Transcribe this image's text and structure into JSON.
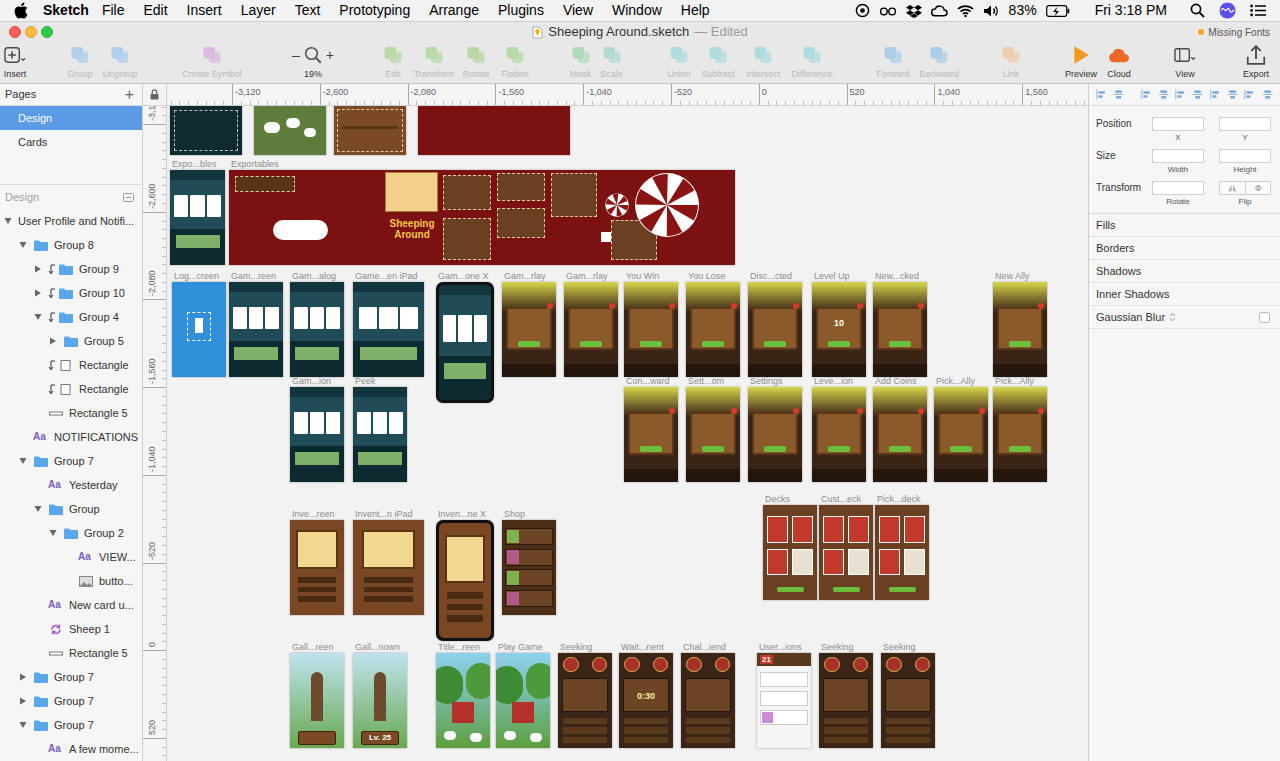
{
  "menubar": {
    "app": "Sketch",
    "menus": [
      "File",
      "Edit",
      "Insert",
      "Layer",
      "Text",
      "Prototyping",
      "Arrange",
      "Plugins",
      "View",
      "Window",
      "Help"
    ],
    "battery": "83%",
    "clock": "Fri 3:18 PM"
  },
  "window": {
    "title": "Sheeping Around.sketch",
    "edited": "— Edited",
    "warning": "Missing Fonts"
  },
  "toolbar": {
    "clusters": [
      {
        "items": [
          {
            "label": "Insert",
            "disabled": false,
            "color": "#4a4a4a"
          }
        ]
      },
      {
        "items": [
          {
            "label": "Group",
            "disabled": true,
            "color": "#8cc0ec"
          },
          {
            "label": "Ungroup",
            "disabled": true,
            "color": "#8cc0ec"
          }
        ]
      },
      {
        "items": [
          {
            "label": "Create Symbol",
            "disabled": true,
            "color": "#d6a0e0"
          }
        ]
      },
      {
        "items": [
          {
            "label": "Edit",
            "disabled": true,
            "color": "#9ccf7f"
          },
          {
            "label": "Transform",
            "disabled": true,
            "color": "#9ccf7f"
          },
          {
            "label": "Rotate",
            "disabled": true,
            "color": "#9ccf7f"
          },
          {
            "label": "Flatten",
            "disabled": true,
            "color": "#9ccf7f"
          }
        ]
      },
      {
        "items": [
          {
            "label": "Mask",
            "disabled": true,
            "color": "#8fd0a0"
          },
          {
            "label": "Scale",
            "disabled": true,
            "color": "#8fd0c8"
          }
        ]
      },
      {
        "items": [
          {
            "label": "Union",
            "disabled": true,
            "color": "#8ed3d6"
          },
          {
            "label": "Subtract",
            "disabled": true,
            "color": "#8ed3d6"
          },
          {
            "label": "Intersect",
            "disabled": true,
            "color": "#8ed3d6"
          },
          {
            "label": "Difference",
            "disabled": true,
            "color": "#8ed3d6"
          }
        ]
      },
      {
        "items": [
          {
            "label": "Forward",
            "disabled": true,
            "color": "#86bde8"
          },
          {
            "label": "Backward",
            "disabled": true,
            "color": "#86bde8"
          }
        ]
      },
      {
        "items": [
          {
            "label": "Link",
            "disabled": true,
            "color": "#f0c08c"
          }
        ]
      },
      {
        "items": [
          {
            "label": "Preview",
            "disabled": false,
            "color": "#f39a1c"
          },
          {
            "label": "Cloud",
            "disabled": false,
            "color": "#ef6a2a"
          }
        ]
      },
      {
        "items": [
          {
            "label": "View",
            "disabled": false,
            "color": "#4a4a4a"
          }
        ]
      },
      {
        "items": [
          {
            "label": "Export",
            "disabled": false,
            "color": "#4a4a4a"
          }
        ]
      }
    ],
    "zoom": {
      "minus": "–",
      "plus": "+",
      "value": "19%"
    }
  },
  "pages": {
    "header": "Pages",
    "add": "+",
    "items": [
      {
        "label": "Design",
        "selected": true
      },
      {
        "label": "Cards",
        "selected": false
      }
    ]
  },
  "layers": {
    "header": "Design",
    "items": [
      {
        "name": "User Profile and Notifi...",
        "kind": "artboard",
        "depth": 0,
        "expandable": true,
        "expanded": true,
        "masked": false
      },
      {
        "name": "Group 8",
        "kind": "group",
        "depth": 1,
        "expandable": true,
        "expanded": true,
        "masked": false
      },
      {
        "name": "Group 9",
        "kind": "group",
        "depth": 2,
        "expandable": true,
        "expanded": false,
        "masked": true
      },
      {
        "name": "Group 10",
        "kind": "group",
        "depth": 2,
        "expandable": true,
        "expanded": false,
        "masked": true
      },
      {
        "name": "Group 4",
        "kind": "group",
        "depth": 2,
        "expandable": true,
        "expanded": true,
        "masked": true
      },
      {
        "name": "Group 5",
        "kind": "group",
        "depth": 3,
        "expandable": true,
        "expanded": false,
        "masked": false
      },
      {
        "name": "Rectangle",
        "kind": "shape",
        "depth": 2,
        "expandable": false,
        "expanded": false,
        "masked": true
      },
      {
        "name": "Rectangle",
        "kind": "shape",
        "depth": 2,
        "expandable": false,
        "expanded": false,
        "masked": true
      },
      {
        "name": "Rectangle 5",
        "kind": "line",
        "depth": 2,
        "expandable": false,
        "expanded": false,
        "masked": false
      },
      {
        "name": "NOTIFICATIONS",
        "kind": "text",
        "icon_text": "Aa",
        "depth": 1,
        "expandable": false,
        "expanded": false,
        "masked": false
      },
      {
        "name": "Group 7",
        "kind": "group",
        "depth": 1,
        "expandable": true,
        "expanded": true,
        "masked": false
      },
      {
        "name": "Yesterday",
        "kind": "text",
        "icon_text": "Aa",
        "depth": 2,
        "expandable": false,
        "expanded": false,
        "masked": false
      },
      {
        "name": "Group",
        "kind": "group",
        "depth": 2,
        "expandable": true,
        "expanded": true,
        "masked": false
      },
      {
        "name": "Group 2",
        "kind": "group",
        "depth": 3,
        "expandable": true,
        "expanded": true,
        "masked": false
      },
      {
        "name": "VIEW...",
        "kind": "text",
        "icon_text": "Aa",
        "depth": 4,
        "expandable": false,
        "expanded": false,
        "masked": false
      },
      {
        "name": "butto...",
        "kind": "image",
        "depth": 4,
        "expandable": false,
        "expanded": false,
        "masked": false
      },
      {
        "name": "New card u...",
        "kind": "text",
        "icon_text": "Aa",
        "depth": 2,
        "expandable": false,
        "expanded": false,
        "masked": false
      },
      {
        "name": "Sheep 1",
        "kind": "symbol",
        "depth": 2,
        "expandable": false,
        "expanded": false,
        "masked": false
      },
      {
        "name": "Rectangle 5",
        "kind": "line",
        "depth": 2,
        "expandable": false,
        "expanded": false,
        "masked": false
      },
      {
        "name": "Group 7",
        "kind": "group",
        "depth": 1,
        "expandable": true,
        "expanded": false,
        "masked": false
      },
      {
        "name": "Group 7",
        "kind": "group",
        "depth": 1,
        "expandable": true,
        "expanded": false,
        "masked": false
      },
      {
        "name": "Group 7",
        "kind": "group",
        "depth": 1,
        "expandable": true,
        "expanded": true,
        "masked": false
      },
      {
        "name": "A few mome...",
        "kind": "text",
        "icon_text": "Aa",
        "depth": 2,
        "expandable": false,
        "expanded": false,
        "masked": false
      }
    ]
  },
  "rulers": {
    "x": [
      "-3,120",
      "-2,600",
      "-2,080",
      "-1,560",
      "-1,040",
      "-520",
      "0",
      "520",
      "1,040",
      "1,560"
    ],
    "y": [
      "-3,1",
      "-2,600",
      "-2,080",
      "-1,560",
      "-1,040",
      "-520",
      "0",
      "520"
    ]
  },
  "inspector": {
    "rows": [
      {
        "label": "Position",
        "captions": [
          "X",
          "Y"
        ]
      },
      {
        "label": "Size",
        "captions": [
          "Width",
          "Height"
        ]
      }
    ],
    "transform": {
      "label": "Transform",
      "rotate": "Rotate",
      "flip": "Flip"
    },
    "sections": [
      {
        "label": "Fills"
      },
      {
        "label": "Borders"
      },
      {
        "label": "Shadows"
      },
      {
        "label": "Inner Shadows"
      },
      {
        "label": "Gaussian Blur",
        "checked": false
      }
    ]
  },
  "canvas": {
    "artboards": [
      {
        "kind": "dark"
      },
      {
        "kind": "sheep"
      },
      {
        "kind": "crate"
      },
      {
        "kind": "red"
      },
      {
        "label": "Expo...bles",
        "kind": "game"
      },
      {
        "label": "Exportables",
        "kind": "sheet",
        "text": "Sheeping Around"
      },
      {
        "label": "Log...creen",
        "kind": "splash"
      },
      {
        "label": "Gam...reen",
        "kind": "game"
      },
      {
        "label": "Gam...alog",
        "kind": "game"
      },
      {
        "label": "Game...en iPad",
        "kind": "game"
      },
      {
        "label": "Gam...one X",
        "kind": "phone"
      },
      {
        "label": "Gam...rlay",
        "kind": "modal"
      },
      {
        "label": "Gam...rlay",
        "kind": "modal"
      },
      {
        "label": "You Win",
        "kind": "modal"
      },
      {
        "label": "You Lose",
        "kind": "modal"
      },
      {
        "label": "Disc...cted",
        "kind": "modal"
      },
      {
        "label": "Level Up",
        "kind": "modal",
        "text": "10"
      },
      {
        "label": "New...cked",
        "kind": "modal"
      },
      {
        "label": "New Ally",
        "kind": "modal"
      },
      {
        "label": "Gam...ion",
        "kind": "game"
      },
      {
        "label": "Peek",
        "kind": "game"
      },
      {
        "label": "Con...ward",
        "kind": "modal"
      },
      {
        "label": "Sett...om",
        "kind": "modal"
      },
      {
        "label": "Settings",
        "kind": "modal"
      },
      {
        "label": "Leve...ion",
        "kind": "modal"
      },
      {
        "label": "Add Coins",
        "kind": "modal"
      },
      {
        "label": "Pick...Ally",
        "kind": "modal"
      },
      {
        "label": "Pick...Ally",
        "kind": "modal"
      },
      {
        "label": "Inve...reen",
        "kind": "inventory"
      },
      {
        "label": "Invent...n iPad",
        "kind": "inventory"
      },
      {
        "label": "Inven...ne X",
        "kind": "handset"
      },
      {
        "label": "Shop",
        "kind": "shop"
      },
      {
        "label": "Decks",
        "kind": "deck"
      },
      {
        "label": "Cust...eck",
        "kind": "deck"
      },
      {
        "label": "Pick...deck",
        "kind": "deck"
      },
      {
        "label": "Gall...reen",
        "kind": "gallery"
      },
      {
        "label": "Gall...nown",
        "kind": "gallery",
        "text": "Lv. 25"
      },
      {
        "label": "Title...reen",
        "kind": "farm"
      },
      {
        "label": "Play Game",
        "kind": "farm"
      },
      {
        "label": "Seeking",
        "kind": "seek"
      },
      {
        "label": "Wait...nent",
        "kind": "seek",
        "text": "0:30"
      },
      {
        "label": "Chal...iend",
        "kind": "seek"
      },
      {
        "label": "User...ions",
        "kind": "list",
        "text": "21"
      },
      {
        "label": "Seeking",
        "kind": "seek"
      },
      {
        "label": "Seeking",
        "kind": "seek"
      }
    ]
  }
}
